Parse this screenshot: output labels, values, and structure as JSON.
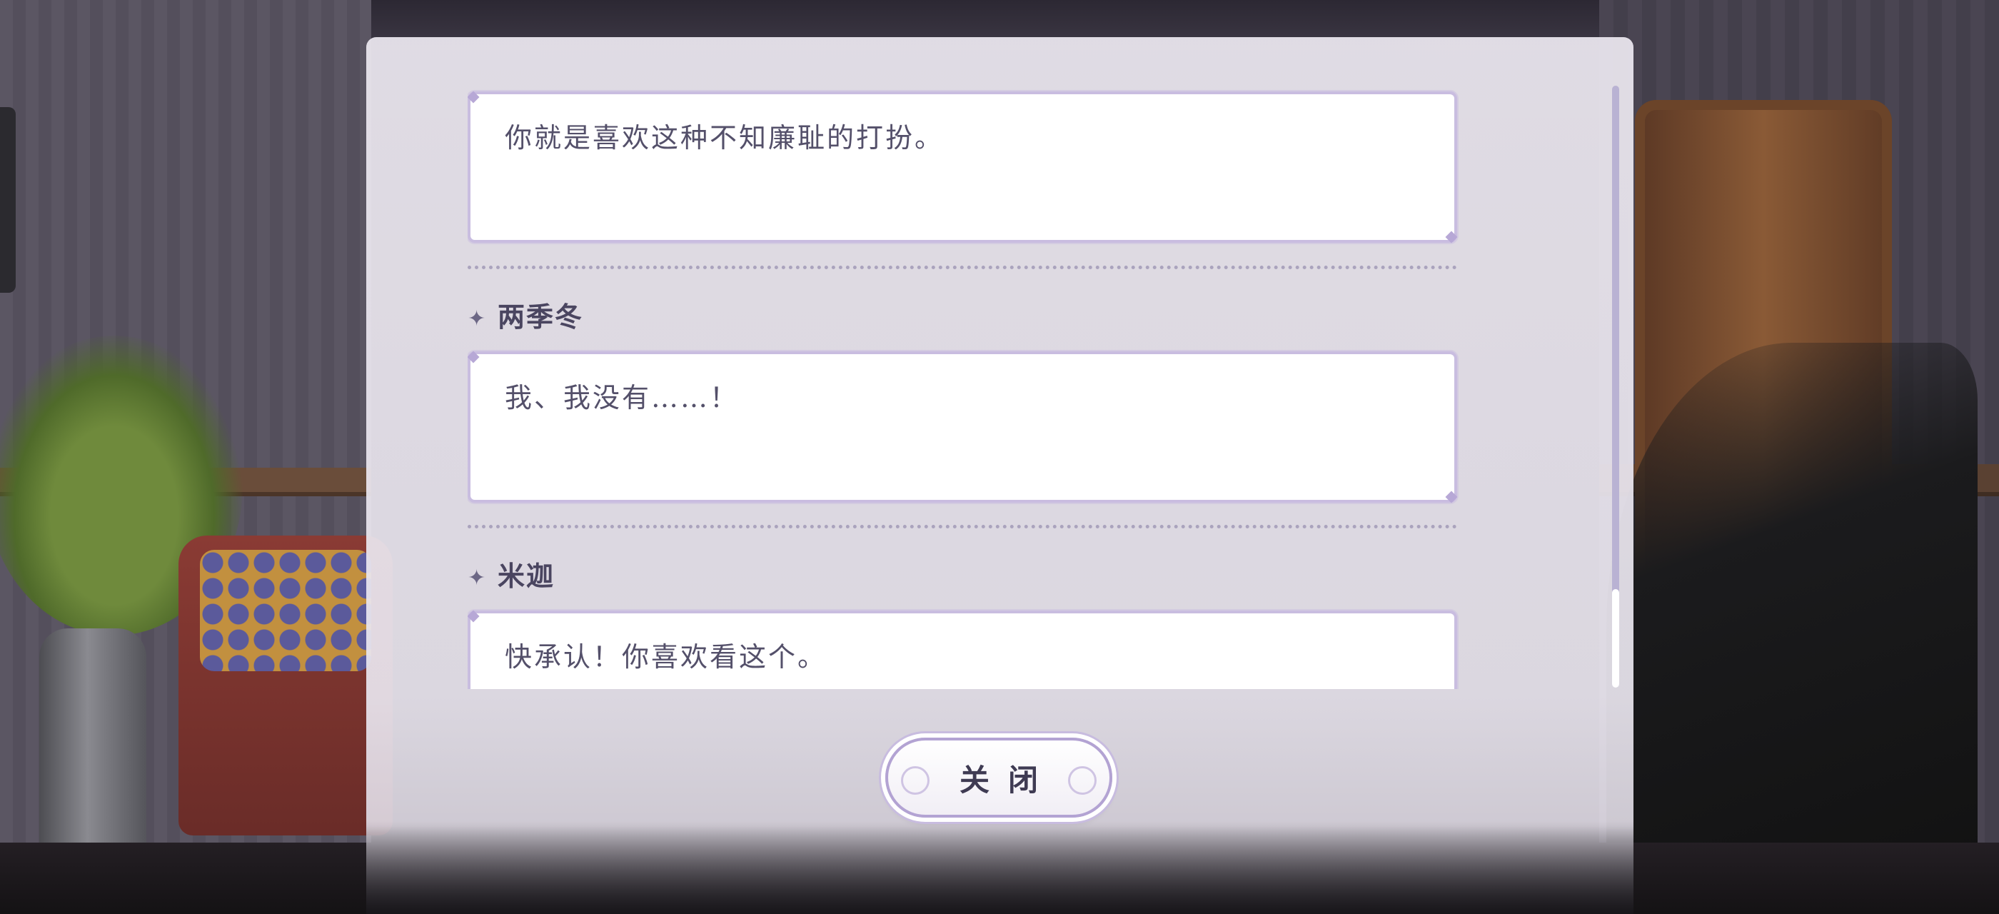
{
  "dialogue_log": {
    "entries": [
      {
        "speaker": "",
        "text": "你就是喜欢这种不知廉耻的打扮。"
      },
      {
        "speaker": "两季冬",
        "text": "我、我没有……！"
      },
      {
        "speaker": "米迦",
        "text": "快承认！你喜欢看这个。"
      }
    ]
  },
  "close_button": {
    "label": "关闭"
  },
  "colors": {
    "panel_bg": "#ece8f0",
    "box_border": "#c9bde0",
    "text": "#54506a",
    "name_text": "#4a4560",
    "scrollbar_track": "#b9b2d3",
    "scrollbar_thumb": "#ffffff"
  },
  "icons": {
    "speaker_marker": "four-point-star-icon"
  },
  "scroll": {
    "thumb_position_fraction": 0.83
  }
}
